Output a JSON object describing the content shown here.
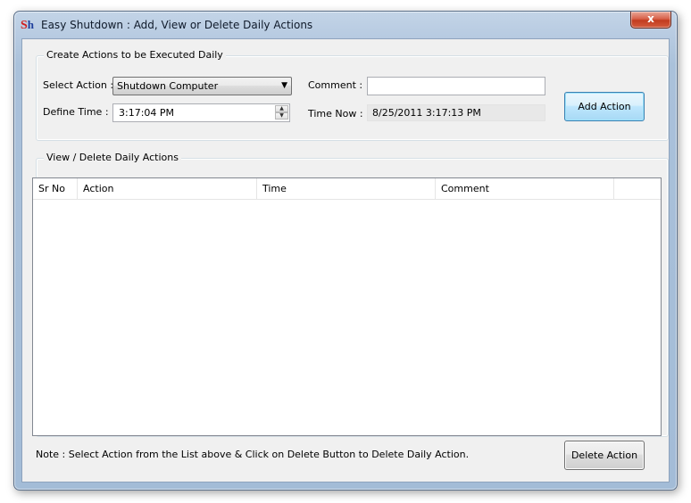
{
  "window": {
    "title": "Easy Shutdown : Add, View or Delete Daily Actions",
    "icon_text_s": "S",
    "icon_text_h": "h",
    "close_glyph": "x"
  },
  "create_group": {
    "label": "Create Actions to be Executed Daily",
    "select_action_label": "Select Action :",
    "select_action_value": "Shutdown Computer",
    "define_time_label": "Define Time :",
    "define_time_value": "3:17:04 PM",
    "comment_label": "Comment :",
    "comment_value": "",
    "time_now_label": "Time Now :",
    "time_now_value": "8/25/2011 3:17:13 PM",
    "add_button": "Add Action"
  },
  "view_group": {
    "label": "View / Delete Daily Actions",
    "columns": [
      "Sr No",
      "Action",
      "Time",
      "Comment"
    ],
    "rows": []
  },
  "footer": {
    "note": "Note : Select Action from the List above & Click on Delete Button to Delete Daily Action.",
    "delete_button": "Delete Action"
  },
  "icons": {
    "dropdown": "chevron-down-icon",
    "spin_up": "spin-up-icon",
    "spin_down": "spin-down-icon",
    "app": "app-logo-icon",
    "close": "close-icon"
  },
  "colors": {
    "close_button": "#c23c1f",
    "default_button_border": "#3c7fb1",
    "window_frame": "#b9cce2",
    "client_bg": "#f0f0f0"
  }
}
